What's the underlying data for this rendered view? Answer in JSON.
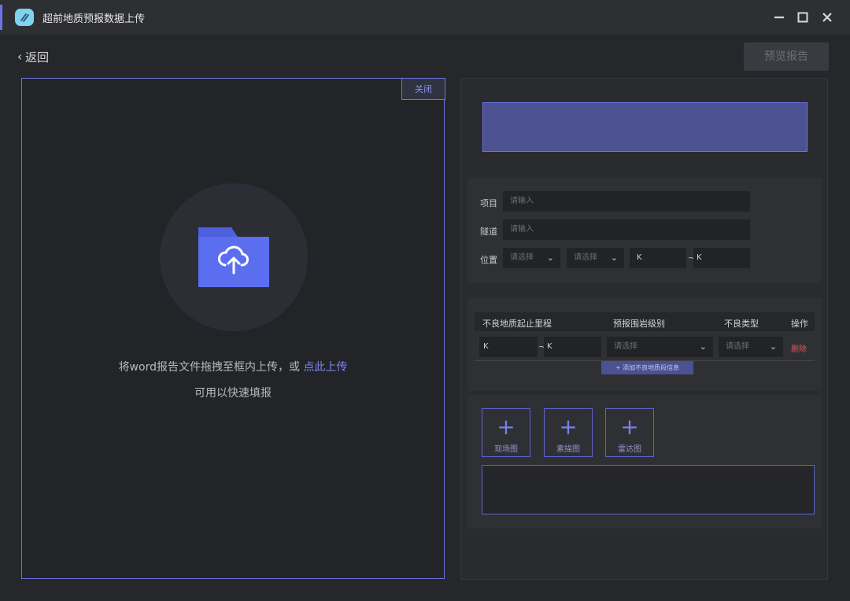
{
  "app": {
    "title": "超前地质预报数据上传"
  },
  "window_controls": {
    "minimize": "—",
    "maximize": "☐",
    "close": "✕"
  },
  "nav": {
    "back_label": "返回",
    "preview_label": "预览报告"
  },
  "upload": {
    "close_label": "关闭",
    "prompt": "将word报告文件拖拽至框内上传，或",
    "link": "点此上传",
    "subtext": "可用以快速填报"
  },
  "form": {
    "project": {
      "label": "项目",
      "placeholder": "请输入"
    },
    "tunnel": {
      "label": "隧道",
      "placeholder": "请输入"
    },
    "position": {
      "label": "位置",
      "select1": "请选择",
      "select2": "请选择",
      "k_start": "K",
      "tilde": "~",
      "k_end": "K"
    }
  },
  "geo_table": {
    "headers": [
      "不良地质起止里程",
      "预报围岩级别",
      "不良类型",
      "操作"
    ],
    "row": {
      "k_start": "K",
      "tilde": "~",
      "k_end": "K",
      "rock_level": "请选择",
      "bad_type": "请选择",
      "delete": "删除"
    },
    "add_label": "+ 添加不良地质段信息"
  },
  "media": {
    "items": [
      {
        "label": "现场图"
      },
      {
        "label": "素描图"
      },
      {
        "label": "雷达图"
      }
    ]
  },
  "colors": {
    "accent": "#6c72e0",
    "banner": "#4b5191",
    "delete": "#e05555",
    "folder": "#5c6ef0"
  }
}
